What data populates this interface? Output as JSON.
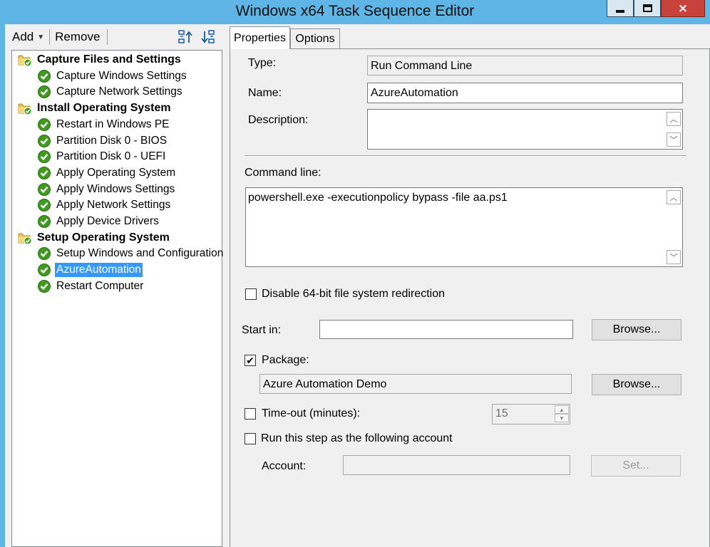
{
  "window": {
    "title": "Windows x64 Task Sequence Editor",
    "controls": {
      "minimize": "minimize-icon",
      "maximize": "maximize-icon",
      "close": "×"
    }
  },
  "toolbar": {
    "add_label": "Add",
    "remove_label": "Remove",
    "icons": [
      "move-up-icon",
      "move-down-icon"
    ]
  },
  "tree": {
    "groups": [
      {
        "label": "Capture Files and Settings",
        "steps": [
          "Capture Windows Settings",
          "Capture Network Settings"
        ]
      },
      {
        "label": "Install Operating System",
        "steps": [
          "Restart in Windows PE",
          "Partition Disk 0 - BIOS",
          "Partition Disk 0 - UEFI",
          "Apply Operating System",
          "Apply Windows Settings",
          "Apply Network Settings",
          "Apply Device Drivers"
        ]
      },
      {
        "label": "Setup Operating System",
        "steps": [
          "Setup Windows and Configuration",
          "AzureAutomation",
          "Restart Computer"
        ]
      }
    ],
    "selected": "AzureAutomation"
  },
  "tabs": [
    {
      "label": "Properties",
      "active": true
    },
    {
      "label": "Options",
      "active": false
    }
  ],
  "properties": {
    "type_label": "Type:",
    "type_value": "Run Command Line",
    "name_label": "Name:",
    "name_value": "AzureAutomation",
    "description_label": "Description:",
    "description_value": "",
    "command_line_label": "Command line:",
    "command_line_value": "powershell.exe -executionpolicy bypass -file aa.ps1",
    "disable_redirection_label": "Disable 64-bit file system redirection",
    "disable_redirection_checked": false,
    "start_in_label": "Start in:",
    "start_in_value": "",
    "browse_label": "Browse...",
    "package_label": "Package:",
    "package_checked": true,
    "package_value": "Azure Automation Demo",
    "package_browse_label": "Browse...",
    "timeout_label": "Time-out (minutes):",
    "timeout_checked": false,
    "timeout_value": "15",
    "run_as_label": "Run this step as the following account",
    "run_as_checked": false,
    "account_label": "Account:",
    "account_value": "",
    "set_label": "Set..."
  },
  "colors": {
    "titlebar": "#5fb6e6",
    "selection": "#3399ff",
    "close_button": "#c7423a",
    "step_icon_green": "#3f9b1f",
    "folder_yellow": "#e8c65a"
  }
}
